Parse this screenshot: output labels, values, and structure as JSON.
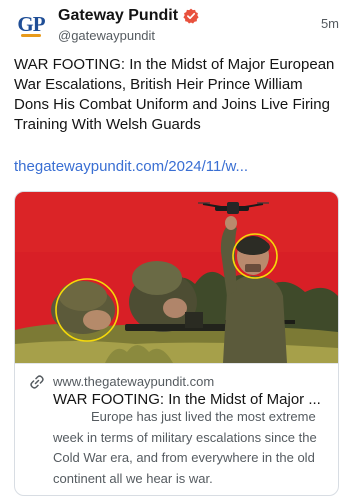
{
  "author": {
    "avatar_text": "GP",
    "display_name": "Gateway Pundit",
    "handle": "@gatewaypundit",
    "verified_icon": "verified-badge-icon"
  },
  "post": {
    "time_ago": "5m",
    "text": "WAR FOOTING: In the Midst of Major European War Escalations, British Heir Prince William Dons His Combat Uniform and Joins Live Firing Training With Welsh Guards",
    "link_text": "thegatewaypundit.com/2024/11/w..."
  },
  "link_card": {
    "image_description": "Soldiers in camouflage with a drone against a red background",
    "link_icon": "link-icon",
    "domain": "www.thegatewaypundit.com",
    "title": "WAR FOOTING: In the Midst of Major ...",
    "description": "Europe has just lived the most extreme week in terms of military escalations since the Cold War era, and from everywhere in the old continent all we hear is war."
  },
  "colors": {
    "accent_link": "#3a6fd3",
    "verified": "#e8513d",
    "image_background": "#d81f26",
    "highlight_circle": "#f5d90a"
  }
}
